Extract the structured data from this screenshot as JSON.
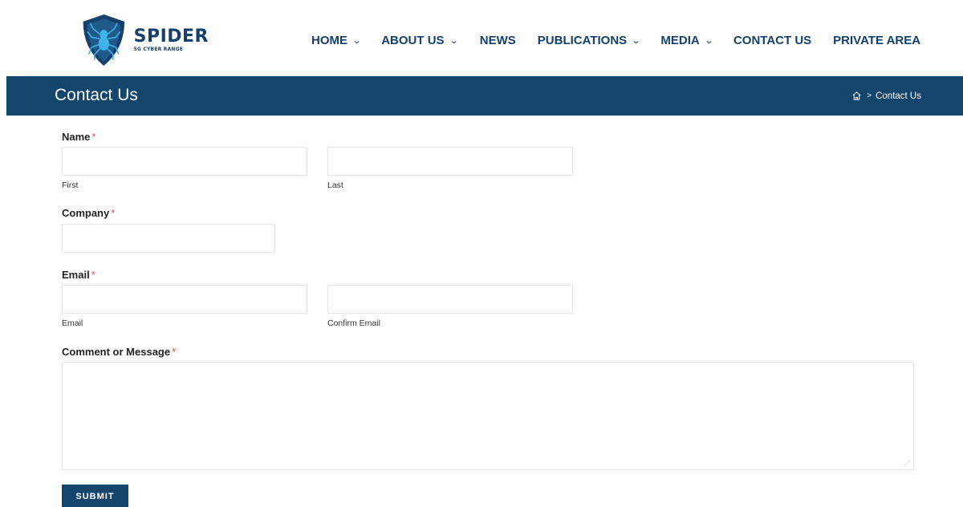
{
  "brand": {
    "name": "SPIDER",
    "tagline": "5G CYBER RANGE",
    "primary_color": "#14406b",
    "accent_color": "#2a9fd6"
  },
  "nav": {
    "items": [
      {
        "label": "HOME",
        "has_dropdown": true
      },
      {
        "label": "ABOUT US",
        "has_dropdown": true
      },
      {
        "label": "NEWS",
        "has_dropdown": false
      },
      {
        "label": "PUBLICATIONS",
        "has_dropdown": true
      },
      {
        "label": "MEDIA",
        "has_dropdown": true
      },
      {
        "label": "CONTACT US",
        "has_dropdown": false
      },
      {
        "label": "PRIVATE AREA",
        "has_dropdown": false
      }
    ],
    "dropdown_icon": "chevron-down-icon"
  },
  "titlebar": {
    "title": "Contact Us",
    "breadcrumb": {
      "home_icon": "home-icon",
      "separator": ">",
      "current": "Contact Us"
    }
  },
  "form": {
    "required_marker": "*",
    "name": {
      "label": "Name",
      "first": {
        "value": "",
        "sublabel": "First"
      },
      "last": {
        "value": "",
        "sublabel": "Last"
      }
    },
    "company": {
      "label": "Company",
      "value": ""
    },
    "email": {
      "label": "Email",
      "email": {
        "value": "",
        "sublabel": "Email"
      },
      "confirm": {
        "value": "",
        "sublabel": "Confirm Email"
      }
    },
    "message": {
      "label": "Comment or Message",
      "value": ""
    },
    "submit_label": "SUBMIT"
  }
}
